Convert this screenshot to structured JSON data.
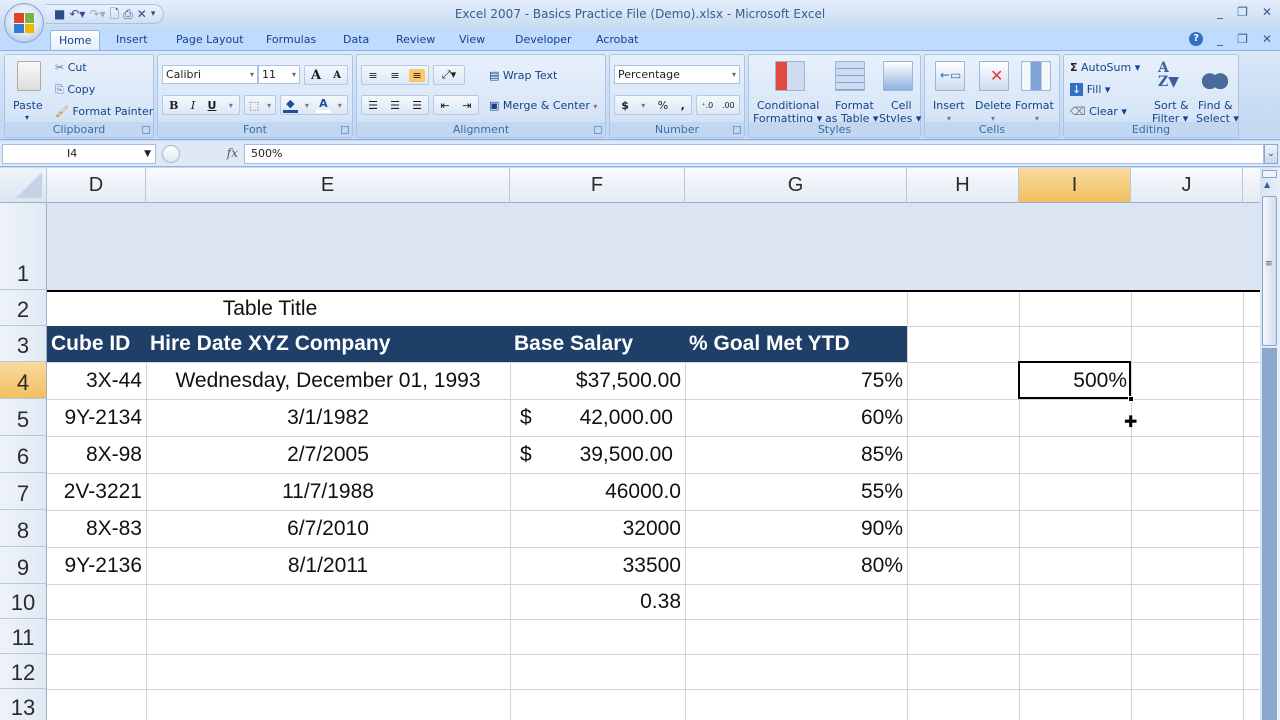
{
  "window": {
    "title": "Excel 2007 - Basics Practice File (Demo).xlsx - Microsoft Excel",
    "controls": [
      "_",
      "❐",
      "✕"
    ],
    "doc_controls": [
      "?",
      "_",
      "❐",
      "✕"
    ]
  },
  "quick_access": [
    {
      "name": "save",
      "glyph": "💾"
    },
    {
      "name": "undo",
      "glyph": "↶▾"
    },
    {
      "name": "redo",
      "glyph": "↷▾"
    },
    {
      "name": "print-preview",
      "glyph": "🔍"
    },
    {
      "name": "print",
      "glyph": "🖶"
    },
    {
      "name": "close",
      "glyph": "✕"
    },
    {
      "name": "customize",
      "glyph": "▾"
    }
  ],
  "tabs": [
    "Home",
    "Insert",
    "Page Layout",
    "Formulas",
    "Data",
    "Review",
    "View",
    "Developer",
    "Acrobat"
  ],
  "active_tab": "Home",
  "ribbon": {
    "clipboard": {
      "label": "Clipboard",
      "paste": "Paste",
      "cut": "Cut",
      "copy": "Copy",
      "format_painter": "Format Painter"
    },
    "font": {
      "label": "Font",
      "font_name": "Calibri",
      "font_size": "11",
      "bold": "B",
      "italic": "I",
      "underline": "U",
      "grow": "A",
      "shrink": "A",
      "font_color": "A"
    },
    "alignment": {
      "label": "Alignment",
      "wrap_text": "Wrap Text",
      "merge_center": "Merge & Center"
    },
    "number": {
      "label": "Number",
      "format": "Percentage",
      "currency": "$",
      "percent": "%",
      "comma": ",",
      "inc_decimal": "←.0 .00",
      "dec_decimal": ".00 →.0"
    },
    "styles": {
      "label": "Styles",
      "conditional_formatting": [
        "Conditional",
        "Formatting ▾"
      ],
      "format_as_table": [
        "Format",
        "as Table ▾"
      ],
      "cell_styles": [
        "Cell",
        "Styles ▾"
      ]
    },
    "cells": {
      "label": "Cells",
      "insert": "Insert",
      "delete": "Delete",
      "format": "Format"
    },
    "editing": {
      "label": "Editing",
      "autosum": "AutoSum ▾",
      "fill": "Fill ▾",
      "clear": "Clear ▾",
      "sort_filter": [
        "Sort &",
        "Filter ▾"
      ],
      "find_select": [
        "Find &",
        "Select ▾"
      ]
    }
  },
  "formula_bar": {
    "name_box": "I4",
    "fx": "fx",
    "value": "500%"
  },
  "columns": [
    "D",
    "E",
    "F",
    "G",
    "H",
    "I",
    "J"
  ],
  "selected_column": "I",
  "rows": [
    "1",
    "2",
    "3",
    "4",
    "5",
    "6",
    "7",
    "8",
    "9",
    "10",
    "11",
    "12",
    "13"
  ],
  "selected_row": "4",
  "sheet": {
    "title": "Table Title",
    "headers": [
      "Cube ID",
      "Hire Date XYZ Company",
      "Base Salary",
      "% Goal Met YTD"
    ],
    "header_bg": "#1f3f68",
    "records": [
      {
        "id": "3X-44",
        "date": "Wednesday, December 01, 1993",
        "salary": "$37,500.00",
        "salary_sym": "",
        "goal": "75%"
      },
      {
        "id": "9Y-2134",
        "date": "3/1/1982",
        "salary": "42,000.00",
        "salary_sym": "$",
        "goal": "60%"
      },
      {
        "id": "8X-98",
        "date": "2/7/2005",
        "salary": "39,500.00",
        "salary_sym": "$",
        "goal": "85%"
      },
      {
        "id": "2V-3221",
        "date": "11/7/1988",
        "salary": "46000.0",
        "salary_sym": "",
        "goal": "55%"
      },
      {
        "id": "8X-83",
        "date": "6/7/2010",
        "salary": "32000",
        "salary_sym": "",
        "goal": "90%"
      },
      {
        "id": "9Y-2136",
        "date": "8/1/2011",
        "salary": "33500",
        "salary_sym": "",
        "goal": "80%"
      }
    ],
    "f10": "0.38",
    "i4": "500%"
  }
}
